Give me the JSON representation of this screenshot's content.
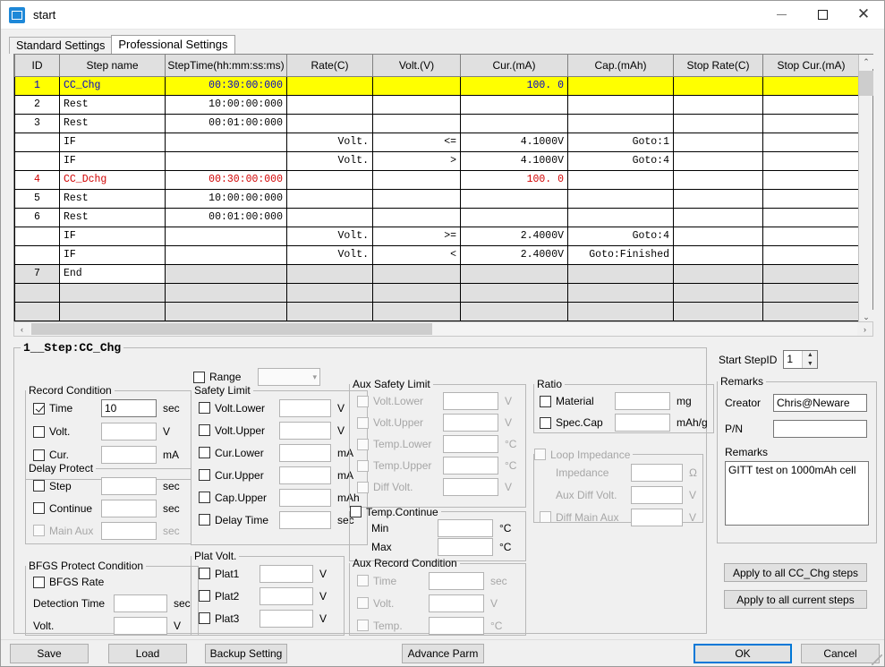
{
  "window": {
    "title": "start",
    "minimize_label": "—",
    "maximize_label": "□",
    "close_label": "✕"
  },
  "tabs": [
    {
      "label": "Standard Settings",
      "active": false
    },
    {
      "label": "Professional Settings",
      "active": true
    }
  ],
  "table": {
    "columns": [
      "ID",
      "Step name",
      "StepTime(hh:mm:ss:ms)",
      "Rate(C)",
      "Volt.(V)",
      "Cur.(mA)",
      "Cap.(mAh)",
      "Stop Rate(C)",
      "Stop Cur.(mA)"
    ],
    "rows": [
      {
        "id": "1",
        "name": "CC_Chg",
        "time": "00:30:00:000",
        "rate": "",
        "volt": "",
        "cur": "100. 0",
        "cap": "",
        "stoprate": "",
        "stopcur": "",
        "style": "selected"
      },
      {
        "id": "2",
        "name": "Rest",
        "time": "10:00:00:000",
        "rate": "",
        "volt": "",
        "cur": "",
        "cap": "",
        "stoprate": "",
        "stopcur": "",
        "style": "normal"
      },
      {
        "id": "3",
        "name": "Rest",
        "time": "00:01:00:000",
        "rate": "",
        "volt": "",
        "cur": "",
        "cap": "",
        "stoprate": "",
        "stopcur": "",
        "style": "normal"
      },
      {
        "id": "",
        "name": "IF",
        "time": "",
        "rate": "Volt.",
        "volt": "<=",
        "cur": "4.1000V",
        "cap": "Goto:1",
        "stoprate": "",
        "stopcur": "",
        "style": "normal"
      },
      {
        "id": "",
        "name": "IF",
        "time": "",
        "rate": "Volt.",
        "volt": ">",
        "cur": "4.1000V",
        "cap": "Goto:4",
        "stoprate": "",
        "stopcur": "",
        "style": "normal"
      },
      {
        "id": "4",
        "name": "CC_Dchg",
        "time": "00:30:00:000",
        "rate": "",
        "volt": "",
        "cur": "100. 0",
        "cap": "",
        "stoprate": "",
        "stopcur": "",
        "style": "red"
      },
      {
        "id": "5",
        "name": "Rest",
        "time": "10:00:00:000",
        "rate": "",
        "volt": "",
        "cur": "",
        "cap": "",
        "stoprate": "",
        "stopcur": "",
        "style": "normal"
      },
      {
        "id": "6",
        "name": "Rest",
        "time": "00:01:00:000",
        "rate": "",
        "volt": "",
        "cur": "",
        "cap": "",
        "stoprate": "",
        "stopcur": "",
        "style": "normal"
      },
      {
        "id": "",
        "name": "IF",
        "time": "",
        "rate": "Volt.",
        "volt": ">=",
        "cur": "2.4000V",
        "cap": "Goto:4",
        "stoprate": "",
        "stopcur": "",
        "style": "normal"
      },
      {
        "id": "",
        "name": "IF",
        "time": "",
        "rate": "Volt.",
        "volt": "<",
        "cur": "2.4000V",
        "cap": "Goto:Finished",
        "stoprate": "",
        "stopcur": "",
        "style": "normal"
      },
      {
        "id": "7",
        "name": "End",
        "time": "",
        "rate": "",
        "volt": "",
        "cur": "",
        "cap": "",
        "stoprate": "",
        "stopcur": "",
        "style": "dim"
      },
      {
        "id": "",
        "name": "",
        "time": "",
        "rate": "",
        "volt": "",
        "cur": "",
        "cap": "",
        "stoprate": "",
        "stopcur": "",
        "style": "blank"
      },
      {
        "id": "",
        "name": "",
        "time": "",
        "rate": "",
        "volt": "",
        "cur": "",
        "cap": "",
        "stoprate": "",
        "stopcur": "",
        "style": "blank"
      }
    ],
    "scroll_up_icon": "⌃",
    "scroll_down_icon": "⌄",
    "scroll_left_icon": "‹",
    "scroll_right_icon": "›"
  },
  "step_panel": {
    "legend": "1__Step:CC_Chg",
    "record_condition": {
      "legend": "Record Condition",
      "items": [
        {
          "label": "Time",
          "checked": true,
          "value": "10",
          "unit": "sec",
          "disabled": false
        },
        {
          "label": "Volt.",
          "checked": false,
          "value": "",
          "unit": "V",
          "disabled": false
        },
        {
          "label": "Cur.",
          "checked": false,
          "value": "",
          "unit": "mA",
          "disabled": false
        }
      ]
    },
    "delay_protect": {
      "legend": "Delay Protect",
      "items": [
        {
          "label": "Step",
          "checked": false,
          "value": "",
          "unit": "sec",
          "disabled": false
        },
        {
          "label": "Continue",
          "checked": false,
          "value": "",
          "unit": "sec",
          "disabled": false
        },
        {
          "label": "Main Aux",
          "checked": false,
          "value": "",
          "unit": "sec",
          "disabled": true
        }
      ]
    },
    "bfgs": {
      "legend": "BFGS Protect Condition",
      "rate": {
        "label": "BFGS Rate",
        "checked": false
      },
      "fields": [
        {
          "label": "Detection Time",
          "value": "",
          "unit": "sec"
        },
        {
          "label": "Volt.",
          "value": "",
          "unit": "V"
        }
      ]
    },
    "range": {
      "label": "Range",
      "checked": false,
      "value": "",
      "dropdown_icon": "⌄"
    },
    "safety_limit": {
      "legend": "Safety Limit",
      "items": [
        {
          "label": "Volt.Lower",
          "checked": false,
          "value": "",
          "unit": "V",
          "disabled": false
        },
        {
          "label": "Volt.Upper",
          "checked": false,
          "value": "",
          "unit": "V",
          "disabled": false
        },
        {
          "label": "Cur.Lower",
          "checked": false,
          "value": "",
          "unit": "mA",
          "disabled": false
        },
        {
          "label": "Cur.Upper",
          "checked": false,
          "value": "",
          "unit": "mA",
          "disabled": false
        },
        {
          "label": "Cap.Upper",
          "checked": false,
          "value": "",
          "unit": "mAh",
          "disabled": false
        },
        {
          "label": "Delay Time",
          "checked": false,
          "value": "",
          "unit": "sec",
          "disabled": false
        }
      ]
    },
    "plat_volt": {
      "legend": "Plat Volt.",
      "items": [
        {
          "label": "Plat1",
          "checked": false,
          "value": "",
          "unit": "V",
          "disabled": false
        },
        {
          "label": "Plat2",
          "checked": false,
          "value": "",
          "unit": "V",
          "disabled": false
        },
        {
          "label": "Plat3",
          "checked": false,
          "value": "",
          "unit": "V",
          "disabled": false
        }
      ]
    },
    "aux_safety_limit": {
      "legend": "Aux Safety Limit",
      "items": [
        {
          "label": "Volt.Lower",
          "checked": false,
          "value": "",
          "unit": "V",
          "disabled": true
        },
        {
          "label": "Volt.Upper",
          "checked": false,
          "value": "",
          "unit": "V",
          "disabled": true
        },
        {
          "label": "Temp.Lower",
          "checked": false,
          "value": "",
          "unit": "°C",
          "disabled": true
        },
        {
          "label": "Temp.Upper",
          "checked": false,
          "value": "",
          "unit": "°C",
          "disabled": true
        },
        {
          "label": "Diff Volt.",
          "checked": false,
          "value": "",
          "unit": "V",
          "disabled": true
        }
      ]
    },
    "temp_continue": {
      "legend": "Temp.Continue",
      "checked": false,
      "items": [
        {
          "label": "Min",
          "value": "",
          "unit": "°C"
        },
        {
          "label": "Max",
          "value": "",
          "unit": "°C"
        }
      ]
    },
    "aux_record_condition": {
      "legend": "Aux Record Condition",
      "items": [
        {
          "label": "Time",
          "checked": false,
          "value": "",
          "unit": "sec",
          "disabled": true
        },
        {
          "label": "Volt.",
          "checked": false,
          "value": "",
          "unit": "V",
          "disabled": true
        },
        {
          "label": "Temp.",
          "checked": false,
          "value": "",
          "unit": "°C",
          "disabled": true
        }
      ]
    },
    "ratio": {
      "legend": "Ratio",
      "items": [
        {
          "label": "Material",
          "checked": false,
          "value": "",
          "unit": "mg",
          "disabled": false
        },
        {
          "label": "Spec.Cap",
          "checked": false,
          "value": "",
          "unit": "mAh/g",
          "disabled": false
        }
      ]
    },
    "loop_impedance": {
      "legend": "Loop Impedance",
      "checked": false,
      "items": [
        {
          "label": "Impedance",
          "checked": null,
          "value": "",
          "unit": "Ω",
          "disabled": true
        },
        {
          "label": "Aux Diff Volt.",
          "checked": null,
          "value": "",
          "unit": "V",
          "disabled": true
        },
        {
          "label": "Diff Main Aux",
          "checked": false,
          "value": "",
          "unit": "V",
          "disabled": true
        }
      ]
    }
  },
  "right_panel": {
    "start_stepid_label": "Start StepID",
    "start_stepid_value": "1",
    "spin_up_icon": "▲",
    "spin_down_icon": "▼",
    "remarks": {
      "legend": "Remarks",
      "creator_label": "Creator",
      "creator_value": "Chris@Neware",
      "pn_label": "P/N",
      "pn_value": "",
      "remarks_label": "Remarks",
      "remarks_value": "GITT test on 1000mAh cell"
    },
    "apply_cc_chg_label": "Apply to all CC_Chg steps",
    "apply_current_label": "Apply to all current steps"
  },
  "bottom_bar": {
    "save": "Save",
    "load": "Load",
    "backup": "Backup Setting",
    "advance": "Advance Parm",
    "ok": "OK",
    "cancel": "Cancel"
  }
}
